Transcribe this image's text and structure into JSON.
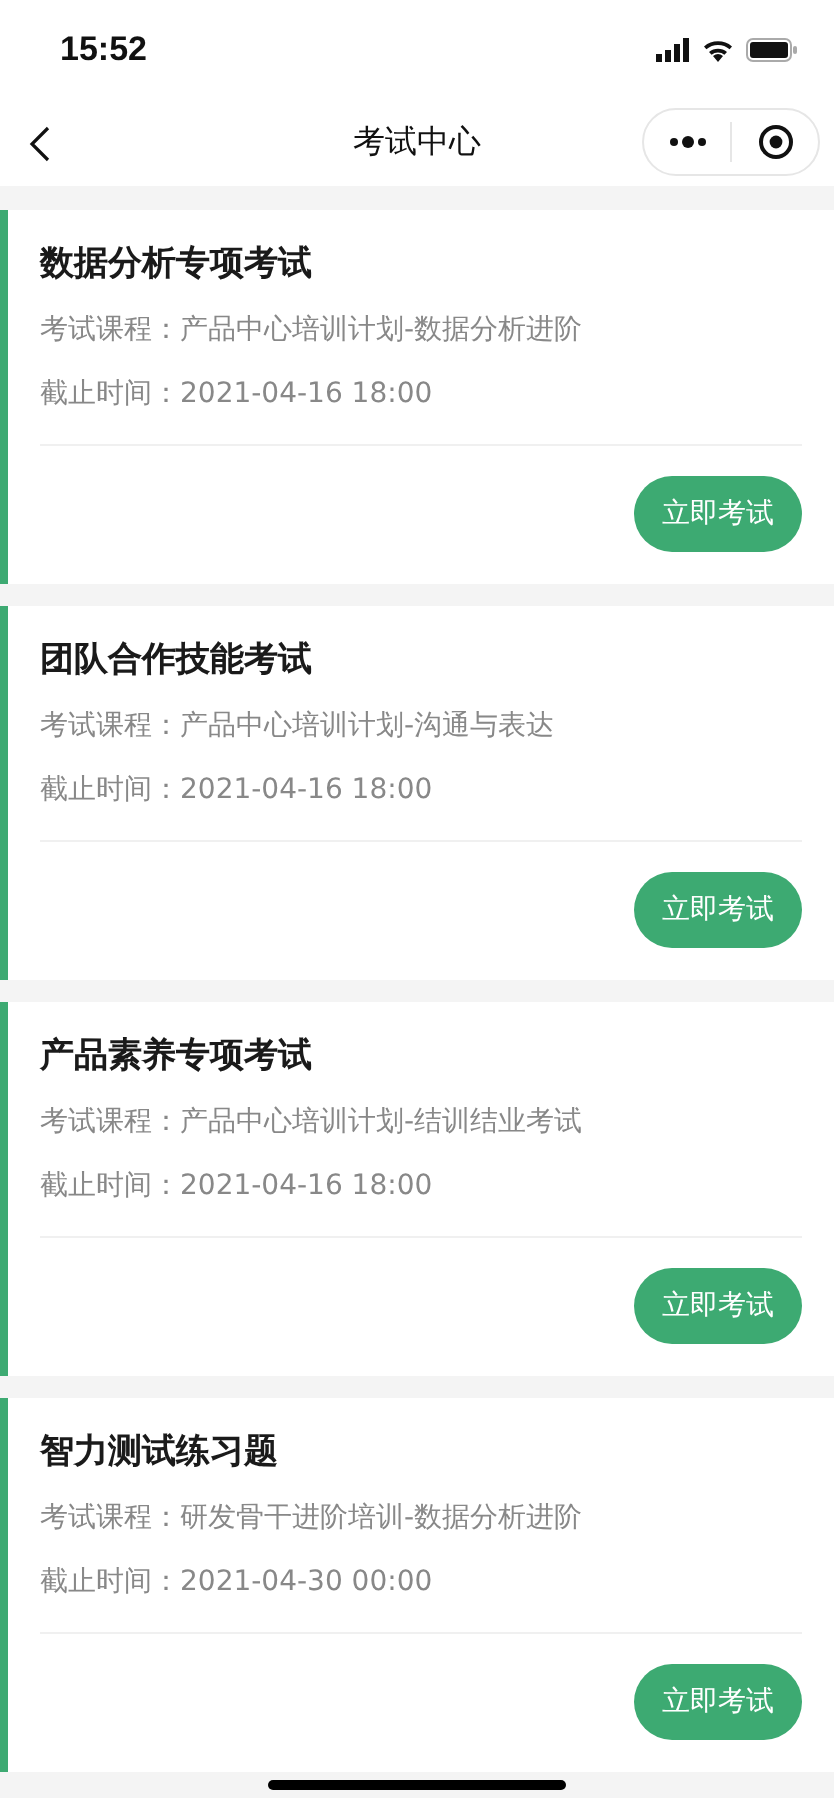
{
  "status_bar": {
    "time": "15:52"
  },
  "nav": {
    "title": "考试中心"
  },
  "exams": [
    {
      "title": "数据分析专项考试",
      "course": "考试课程：产品中心培训计划-数据分析进阶",
      "deadline": "截止时间：2021-04-16 18:00",
      "button": "立即考试"
    },
    {
      "title": "团队合作技能考试",
      "course": "考试课程：产品中心培训计划-沟通与表达",
      "deadline": "截止时间：2021-04-16 18:00",
      "button": "立即考试"
    },
    {
      "title": "产品素养专项考试",
      "course": "考试课程：产品中心培训计划-结训结业考试",
      "deadline": "截止时间：2021-04-16 18:00",
      "button": "立即考试"
    },
    {
      "title": "智力测试练习题",
      "course": "考试课程：研发骨干进阶培训-数据分析进阶",
      "deadline": "截止时间：2021-04-30 00:00",
      "button": "立即考试"
    }
  ]
}
